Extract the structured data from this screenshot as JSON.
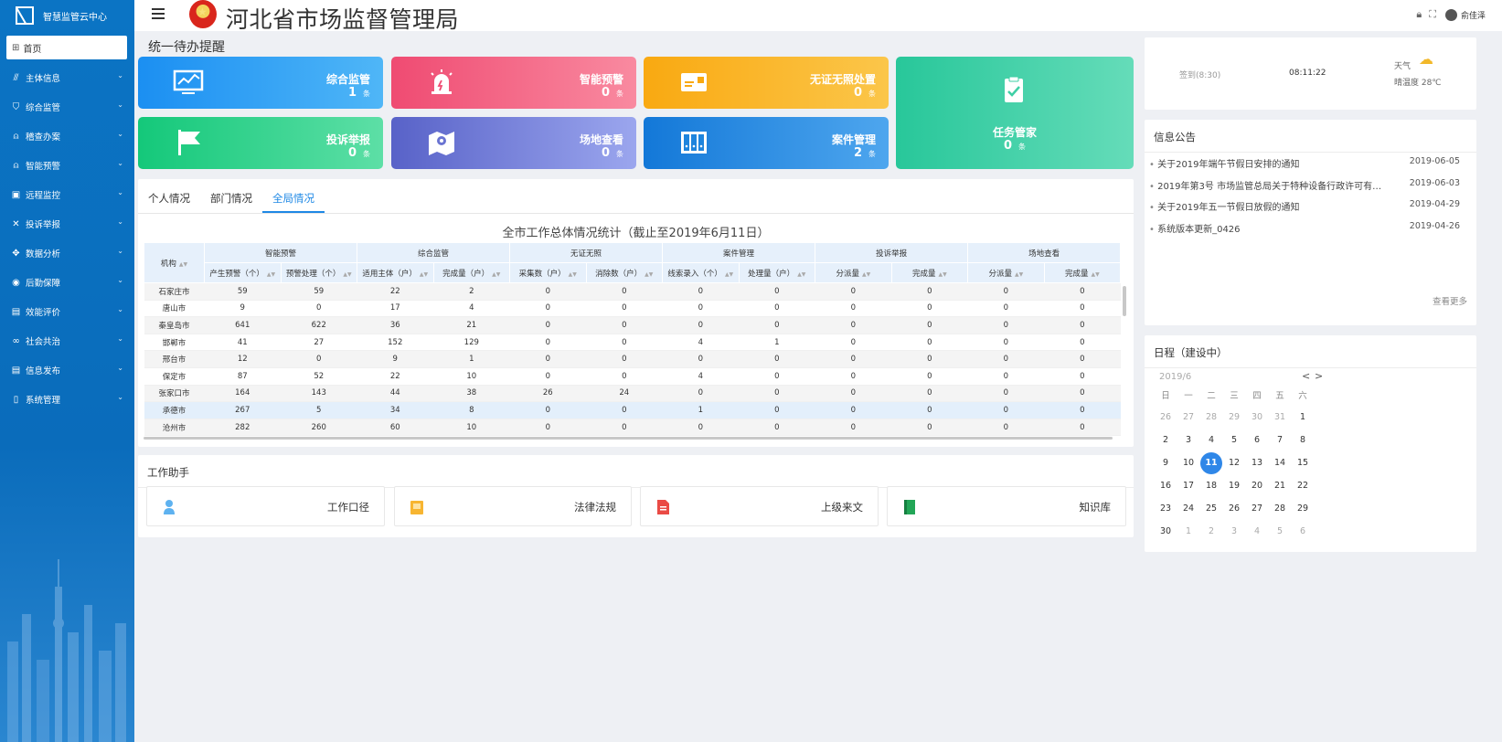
{
  "app": {
    "name": "智慧监管云中心",
    "title": "河北省市场监督管理局"
  },
  "header": {
    "user": "俞佳泽"
  },
  "sidebar": {
    "home": "首页",
    "items": [
      {
        "label": "主体信息",
        "icon": "chart-icon"
      },
      {
        "label": "综合监管",
        "icon": "shield-icon"
      },
      {
        "label": "稽查办案",
        "icon": "bell-icon"
      },
      {
        "label": "智能预警",
        "icon": "bell-icon"
      },
      {
        "label": "远程监控",
        "icon": "monitor-icon"
      },
      {
        "label": "投诉举报",
        "icon": "cross-icon"
      },
      {
        "label": "数据分析",
        "icon": "network-icon"
      },
      {
        "label": "后勤保障",
        "icon": "support-icon"
      },
      {
        "label": "效能评价",
        "icon": "chart-box-icon"
      },
      {
        "label": "社会共治",
        "icon": "link-icon"
      },
      {
        "label": "信息发布",
        "icon": "doc-icon"
      },
      {
        "label": "系统管理",
        "icon": "phone-icon"
      }
    ]
  },
  "todo": {
    "title": "统一待办提醒",
    "cards": [
      {
        "title": "综合监管",
        "count": "1",
        "unit": "条"
      },
      {
        "title": "智能预警",
        "count": "0",
        "unit": "条"
      },
      {
        "title": "无证无照处置",
        "count": "0",
        "unit": "条"
      },
      {
        "title": "投诉举报",
        "count": "0",
        "unit": "条"
      },
      {
        "title": "场地查看",
        "count": "0",
        "unit": "条"
      },
      {
        "title": "案件管理",
        "count": "2",
        "unit": "条"
      },
      {
        "title": "任务管家",
        "count": "0",
        "unit": "条"
      }
    ]
  },
  "tabs": [
    "个人情况",
    "部门情况",
    "全局情况"
  ],
  "stats": {
    "title": "全市工作总体情况统计（截止至2019年6月11日）",
    "org_header": "机构",
    "groups": [
      "智能预警",
      "综合监管",
      "无证无照",
      "案件管理",
      "投诉举报",
      "场地查看"
    ],
    "columns": [
      "产生预警（个）",
      "预警处理（个）",
      "适用主体（户）",
      "完成量（户）",
      "采集数（户）",
      "消除数（户）",
      "线索录入（个）",
      "处理量（户）",
      "分派量",
      "完成量",
      "分派量",
      "完成量"
    ],
    "rows": [
      [
        "石家庄市",
        "59",
        "59",
        "22",
        "2",
        "0",
        "0",
        "0",
        "0",
        "0",
        "0",
        "0",
        "0"
      ],
      [
        "唐山市",
        "9",
        "0",
        "17",
        "4",
        "0",
        "0",
        "0",
        "0",
        "0",
        "0",
        "0",
        "0"
      ],
      [
        "秦皇岛市",
        "641",
        "622",
        "36",
        "21",
        "0",
        "0",
        "0",
        "0",
        "0",
        "0",
        "0",
        "0"
      ],
      [
        "邯郸市",
        "41",
        "27",
        "152",
        "129",
        "0",
        "0",
        "4",
        "1",
        "0",
        "0",
        "0",
        "0"
      ],
      [
        "邢台市",
        "12",
        "0",
        "9",
        "1",
        "0",
        "0",
        "0",
        "0",
        "0",
        "0",
        "0",
        "0"
      ],
      [
        "保定市",
        "87",
        "52",
        "22",
        "10",
        "0",
        "0",
        "4",
        "0",
        "0",
        "0",
        "0",
        "0"
      ],
      [
        "张家口市",
        "164",
        "143",
        "44",
        "38",
        "26",
        "24",
        "0",
        "0",
        "0",
        "0",
        "0",
        "0"
      ],
      [
        "承德市",
        "267",
        "5",
        "34",
        "8",
        "0",
        "0",
        "1",
        "0",
        "0",
        "0",
        "0",
        "0"
      ],
      [
        "沧州市",
        "282",
        "260",
        "60",
        "10",
        "0",
        "0",
        "0",
        "0",
        "0",
        "0",
        "0",
        "0"
      ]
    ]
  },
  "helper": {
    "title": "工作助手",
    "items": [
      {
        "label": "工作口径",
        "icon": "person-icon"
      },
      {
        "label": "法律法规",
        "icon": "book-icon"
      },
      {
        "label": "上级来文",
        "icon": "document-icon"
      },
      {
        "label": "知识库",
        "icon": "library-icon"
      }
    ]
  },
  "checkin": {
    "sign": "签到(8:30)",
    "time": "08:11:22",
    "weather_label": "天气",
    "weather": "晴温度 28℃"
  },
  "notices": {
    "title": "信息公告",
    "items": [
      {
        "text": "关于2019年端午节假日安排的通知",
        "date": "2019-06-05"
      },
      {
        "text": "2019年第3号 市场监管总局关于特种设备行政许可有关事项的公告",
        "date": "2019-06-03"
      },
      {
        "text": "关于2019年五一节假日放假的通知",
        "date": "2019-04-29"
      },
      {
        "text": "系统版本更新_0426",
        "date": "2019-04-26"
      }
    ],
    "more": "查看更多"
  },
  "calendar": {
    "title": "日程（建设中）",
    "month": "2019/6",
    "weekdays": [
      "日",
      "一",
      "二",
      "三",
      "四",
      "五",
      "六"
    ],
    "days": [
      "26",
      "27",
      "28",
      "29",
      "30",
      "31",
      "1",
      "2",
      "3",
      "4",
      "5",
      "6",
      "7",
      "8",
      "9",
      "10",
      "11",
      "12",
      "13",
      "14",
      "15",
      "16",
      "17",
      "18",
      "19",
      "20",
      "21",
      "22",
      "23",
      "24",
      "25",
      "26",
      "27",
      "28",
      "29",
      "30",
      "1",
      "2",
      "3",
      "4",
      "5",
      "6"
    ],
    "today": "11"
  }
}
